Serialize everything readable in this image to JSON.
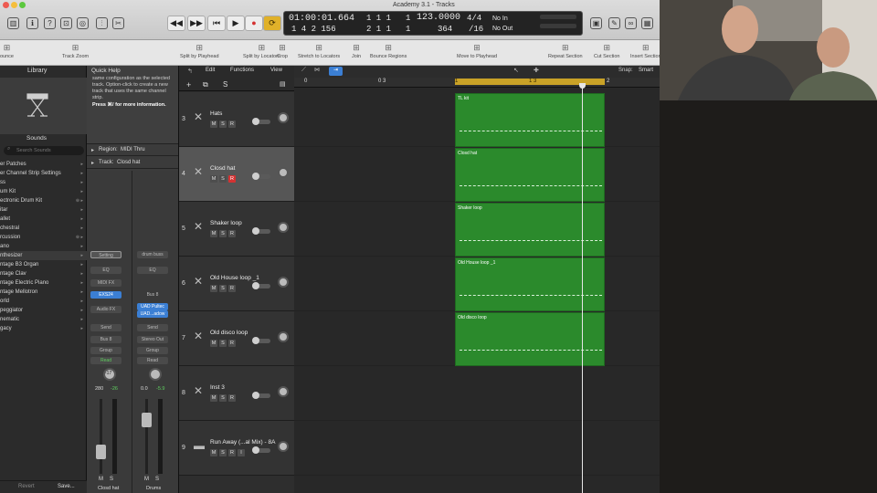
{
  "window": {
    "title": "Academy 3.1 - Tracks"
  },
  "lcd": {
    "time": "01:00:01.664",
    "time_sub": "1 4 2 156",
    "bar_top": "1  1  1",
    "bar_top_right": "1",
    "bar_bottom": "2  1  1",
    "bar_bottom_right": "1",
    "tempo": "123.0000",
    "tempo_sub": "364",
    "sig_top": "4/4",
    "sig_bottom": "/16",
    "in": "No In",
    "out": "No Out"
  },
  "toolbar": [
    {
      "icon": "bounce-icon",
      "label": "ounce"
    },
    {
      "icon": "track-zoom-icon",
      "label": "Track Zoom"
    },
    {
      "icon": "split-playhead-icon",
      "label": "Split by Playhead"
    },
    {
      "icon": "split-locators-icon",
      "label": "Split by Locators"
    },
    {
      "icon": "crop-icon",
      "label": "Crop"
    },
    {
      "icon": "stretch-icon",
      "label": "Stretch to Locators"
    },
    {
      "icon": "join-icon",
      "label": "Join"
    },
    {
      "icon": "bounce-regions-icon",
      "label": "Bounce Regions"
    },
    {
      "icon": "move-playhead-icon",
      "label": "Move to Playhead"
    },
    {
      "icon": "repeat-section-icon",
      "label": "Repeat Section"
    },
    {
      "icon": "cut-section-icon",
      "label": "Cut Section"
    },
    {
      "icon": "insert-section-icon",
      "label": "Insert Section"
    }
  ],
  "library": {
    "title": "Library",
    "sounds": "Sounds",
    "search_placeholder": "Search Sounds",
    "items": [
      "er Patches",
      "er Channel Strip Settings",
      "ss",
      "um Kit",
      "ectronic Drum Kit",
      "itar",
      "allet",
      "chestral",
      "rcussion",
      "ano",
      "nthesizer",
      "ntage B3 Organ",
      "ntage Clav",
      "ntage Electric Piano",
      "ntage Mellotron",
      "orld",
      "peggiator",
      "nematic",
      "gacy"
    ],
    "revert": "Revert",
    "save": "Save..."
  },
  "inspector": {
    "quick_help_title": "Quick Help",
    "quick_help_text": "same configuration as the selected track. Option-click to create a new track that uses the same channel strip.",
    "quick_help_bold": "Press ⌘/ for more information.",
    "region_label": "Region:",
    "region_value": "MIDI Thru",
    "track_label": "Track:",
    "track_value": "Closd hat",
    "strip1": {
      "setting": "Setting",
      "eq": "EQ",
      "midi_fx": "MIDI FX",
      "instrument": "EXS24",
      "audio_fx": "Audio FX",
      "send": "Send",
      "bus": "Bus 8",
      "group": "Group",
      "mode": "Read",
      "knob_value": "-17",
      "val1": "280",
      "val2": "-26",
      "name": "Closd hat",
      "m": "M",
      "s": "S"
    },
    "strip2": {
      "setting": "drum buss",
      "eq": "EQ",
      "bus_top": "Bus 8",
      "plugin1": "UAD Pultec",
      "plugin2": "UAD...adow",
      "send": "Send",
      "output": "Stereo Out",
      "group": "Group",
      "mode": "Read",
      "val1": "0.0",
      "val2": "-5.9",
      "name": "Drums",
      "m": "M",
      "s": "S"
    }
  },
  "tracks_toolbar": {
    "edit": "Edit",
    "functions": "Functions",
    "view": "View",
    "snap_label": "Snap:",
    "snap_value": "Smart",
    "s_button": "S"
  },
  "ruler": [
    "0",
    "0 3",
    "1",
    "1 3",
    "2"
  ],
  "tracks": [
    {
      "num": "3",
      "name": "Hats",
      "region": "TL kit"
    },
    {
      "num": "4",
      "name": "Closd hat",
      "region": "Closd hat"
    },
    {
      "num": "5",
      "name": "Shaker loop",
      "region": "Shaker loop"
    },
    {
      "num": "6",
      "name": "Old House loop _1",
      "region": "Old House loop _1"
    },
    {
      "num": "7",
      "name": "Old disco  loop",
      "region": "Old disco  loop"
    },
    {
      "num": "8",
      "name": "Inst 3",
      "region": ""
    },
    {
      "num": "9",
      "name": "Run Away (...al Mix) - 8A",
      "region": ""
    }
  ],
  "colors": {
    "region": "#2b8a2c",
    "cycle": "#c9a227",
    "record": "#d43232",
    "accent": "#3b7fd4"
  }
}
